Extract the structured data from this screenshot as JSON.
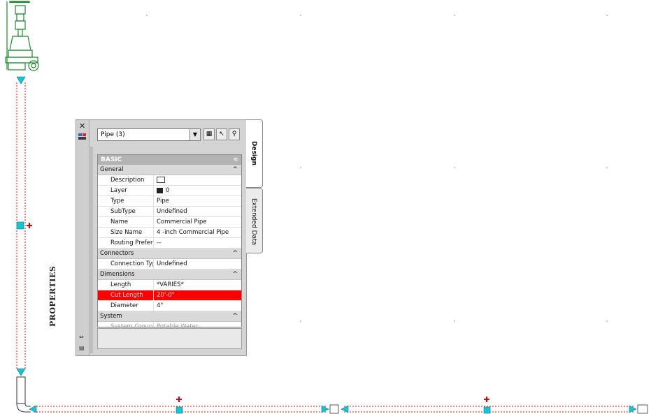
{
  "palette": {
    "title": "PROPERTIES",
    "object_selector": "Pipe (3)",
    "tabs": [
      "Design",
      "Extended Data"
    ],
    "basic_header": "BASIC",
    "categories": {
      "general": "General",
      "connectors": "Connectors",
      "dimensions": "Dimensions",
      "system": "System"
    },
    "general_rows": [
      {
        "key": "Description",
        "value": ""
      },
      {
        "key": "Layer",
        "value": "0"
      },
      {
        "key": "Type",
        "value": "Pipe"
      },
      {
        "key": "SubType",
        "value": "Undefined"
      },
      {
        "key": "Name",
        "value": "Commercial Pipe"
      },
      {
        "key": "Size Name",
        "value": "4 -inch Commercial Pipe"
      },
      {
        "key": "Routing Prefere...",
        "value": "--"
      }
    ],
    "connector_rows": [
      {
        "key": "Connection Type",
        "value": "Undefined"
      }
    ],
    "dimension_rows": [
      {
        "key": "Length",
        "value": "*VARIES*"
      },
      {
        "key": "Cut Length",
        "value": "20'-0\""
      },
      {
        "key": "Diameter",
        "value": "4\""
      }
    ],
    "system_rows": [
      {
        "key": "System Group",
        "value": "Potable Water"
      }
    ]
  },
  "colors": {
    "drawing_line": "#ff0000",
    "grip": "#19c3d6",
    "equipment": "#1a8a2a",
    "highlight_row": "#ff0000"
  }
}
